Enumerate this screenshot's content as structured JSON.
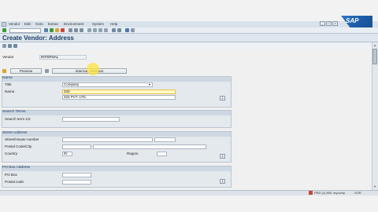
{
  "menu": [
    "Vendor",
    "Edit",
    "Goto",
    "Extras",
    "Environment",
    "System",
    "Help"
  ],
  "brand": "SAP",
  "title": "Create Vendor: Address",
  "vendor": {
    "label": "Vendor",
    "value": "INTERNAL"
  },
  "buttons": {
    "preview": "Preview",
    "international": "Internat. Versions"
  },
  "name_group": {
    "heading": "Name",
    "title_label": "Title",
    "title_value": "Company",
    "name_label": "Name",
    "name_value_1": "333",
    "name_value_2": "333 PVT. LTD."
  },
  "search_group": {
    "heading": "Search Terms",
    "search_label": "Search term 1/2"
  },
  "street_group": {
    "heading": "Street Address",
    "street_label": "Street/House number",
    "postal_label": "Postal Code/City",
    "country_label": "Country",
    "country_value": "IN",
    "region_label": "Region"
  },
  "pobox_group": {
    "heading": "PO Box Address",
    "pobox_label": "PO Box",
    "postal_label": "Postal code"
  },
  "status": {
    "system": "PRD (1) 800",
    "server": "mycomp",
    "mode": "OVR"
  },
  "icons": {
    "enter": "check-icon",
    "save": "save-icon",
    "back": "back-icon",
    "exit": "exit-icon",
    "cancel": "cancel-icon",
    "more": "more-fields-icon"
  }
}
